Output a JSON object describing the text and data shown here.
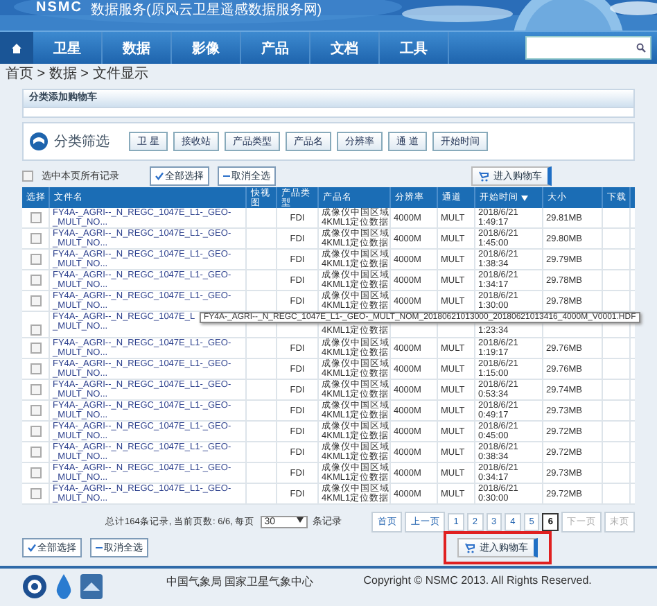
{
  "banner": {
    "logo": "NSMC",
    "title": "数据服务(原风云卫星遥感数据服务网)"
  },
  "nav": {
    "home_active": true,
    "items": [
      {
        "label": "卫星",
        "selected": false
      },
      {
        "label": "数据",
        "selected": false
      },
      {
        "label": "影像",
        "selected": false
      },
      {
        "label": "产品",
        "selected": false
      },
      {
        "label": "文档",
        "selected": false
      },
      {
        "label": "工具",
        "selected": false
      }
    ]
  },
  "breadcrumb": "首页 > 数据 > 文件显示",
  "cart_panel": {
    "title": "分类添加购物车"
  },
  "filter": {
    "title": "分类筛选",
    "buttons": [
      "卫 星",
      "接收站",
      "产品类型",
      "产品名",
      "分辨率",
      "通 道",
      "开始时间"
    ]
  },
  "toolbar": {
    "select_page": {
      "label": "选中本页所有记录",
      "checked": false
    },
    "select_all": "全部选择",
    "deselect": "取消全选",
    "cart": "进入购物车"
  },
  "table": {
    "columns": [
      {
        "label": "选择",
        "sorted": false
      },
      {
        "label": "文件名",
        "sorted": false
      },
      {
        "label": "快视图",
        "sorted": false
      },
      {
        "label": "产品类型",
        "sorted": false
      },
      {
        "label": "产品名",
        "sorted": false
      },
      {
        "label": "分辨率",
        "sorted": false
      },
      {
        "label": "通道",
        "sorted": false
      },
      {
        "label": "开始时间",
        "sorted": true
      },
      {
        "label": "大小",
        "sorted": false
      },
      {
        "label": "下载",
        "sorted": false
      }
    ],
    "rows": [
      {
        "checked": false,
        "file_name": [
          "FY4A-_AGRI--_N_REGC_1047E_L1-_GEO-",
          "_MULT_NO..."
        ],
        "product_type": "FDI",
        "product_name": [
          "成像仪中国区域",
          "4KML1定位数据"
        ],
        "resolution": "4000M",
        "channel": "MULT",
        "start_time": [
          "2018/6/21",
          "1:49:17"
        ],
        "size": "29.81MB"
      },
      {
        "checked": false,
        "file_name": [
          "FY4A-_AGRI--_N_REGC_1047E_L1-_GEO-",
          "_MULT_NO..."
        ],
        "product_type": "FDI",
        "product_name": [
          "成像仪中国区域",
          "4KML1定位数据"
        ],
        "resolution": "4000M",
        "channel": "MULT",
        "start_time": [
          "2018/6/21",
          "1:45:00"
        ],
        "size": "29.80MB"
      },
      {
        "checked": false,
        "file_name": [
          "FY4A-_AGRI--_N_REGC_1047E_L1-_GEO-",
          "_MULT_NO..."
        ],
        "product_type": "FDI",
        "product_name": [
          "成像仪中国区域",
          "4KML1定位数据"
        ],
        "resolution": "4000M",
        "channel": "MULT",
        "start_time": [
          "2018/6/21",
          "1:38:34"
        ],
        "size": "29.79MB"
      },
      {
        "checked": false,
        "file_name": [
          "FY4A-_AGRI--_N_REGC_1047E_L1-_GEO-",
          "_MULT_NO..."
        ],
        "product_type": "FDI",
        "product_name": [
          "成像仪中国区域",
          "4KML1定位数据"
        ],
        "resolution": "4000M",
        "channel": "MULT",
        "start_time": [
          "2018/6/21",
          "1:34:17"
        ],
        "size": "29.78MB"
      },
      {
        "checked": false,
        "file_name": [
          "FY4A-_AGRI--_N_REGC_1047E_L1-_GEO-",
          "_MULT_NO..."
        ],
        "product_type": "FDI",
        "product_name": [
          "成像仪中国区域",
          "4KML1定位数据"
        ],
        "resolution": "4000M",
        "channel": "MULT",
        "start_time": [
          "2018/6/21",
          "1:30:00"
        ],
        "size": "29.78MB"
      },
      {
        "checked": false,
        "file_name": [
          "FY4A-_AGRI--_N_REGC_1047E_L",
          "_MULT_NO..."
        ],
        "product_name": [
          "4KML1定位数据"
        ],
        "start_time": [
          "1:23:34"
        ],
        "tooltip": "FY4A-_AGRI--_N_REGC_1047E_L1-_GEO-_MULT_NOM_20180621013000_20180621013416_4000M_V0001.HDF"
      },
      {
        "checked": false,
        "file_name": [
          "FY4A-_AGRI--_N_REGC_1047E_L1-_GEO-",
          "_MULT_NO..."
        ],
        "product_type": "FDI",
        "product_name": [
          "成像仪中国区域",
          "4KML1定位数据"
        ],
        "resolution": "4000M",
        "channel": "MULT",
        "start_time": [
          "2018/6/21",
          "1:19:17"
        ],
        "size": "29.76MB"
      },
      {
        "checked": false,
        "file_name": [
          "FY4A-_AGRI--_N_REGC_1047E_L1-_GEO-",
          "_MULT_NO..."
        ],
        "product_type": "FDI",
        "product_name": [
          "成像仪中国区域",
          "4KML1定位数据"
        ],
        "resolution": "4000M",
        "channel": "MULT",
        "start_time": [
          "2018/6/21",
          "1:15:00"
        ],
        "size": "29.76MB"
      },
      {
        "checked": false,
        "file_name": [
          "FY4A-_AGRI--_N_REGC_1047E_L1-_GEO-",
          "_MULT_NO..."
        ],
        "product_type": "FDI",
        "product_name": [
          "成像仪中国区域",
          "4KML1定位数据"
        ],
        "resolution": "4000M",
        "channel": "MULT",
        "start_time": [
          "2018/6/21",
          "0:53:34"
        ],
        "size": "29.74MB"
      },
      {
        "checked": false,
        "file_name": [
          "FY4A-_AGRI--_N_REGC_1047E_L1-_GEO-",
          "_MULT_NO..."
        ],
        "product_type": "FDI",
        "product_name": [
          "成像仪中国区域",
          "4KML1定位数据"
        ],
        "resolution": "4000M",
        "channel": "MULT",
        "start_time": [
          "2018/6/21",
          "0:49:17"
        ],
        "size": "29.73MB"
      },
      {
        "checked": false,
        "file_name": [
          "FY4A-_AGRI--_N_REGC_1047E_L1-_GEO-",
          "_MULT_NO..."
        ],
        "product_type": "FDI",
        "product_name": [
          "成像仪中国区域",
          "4KML1定位数据"
        ],
        "resolution": "4000M",
        "channel": "MULT",
        "start_time": [
          "2018/6/21",
          "0:45:00"
        ],
        "size": "29.72MB"
      },
      {
        "checked": false,
        "file_name": [
          "FY4A-_AGRI--_N_REGC_1047E_L1-_GEO-",
          "_MULT_NO..."
        ],
        "product_type": "FDI",
        "product_name": [
          "成像仪中国区域",
          "4KML1定位数据"
        ],
        "resolution": "4000M",
        "channel": "MULT",
        "start_time": [
          "2018/6/21",
          "0:38:34"
        ],
        "size": "29.72MB"
      },
      {
        "checked": false,
        "file_name": [
          "FY4A-_AGRI--_N_REGC_1047E_L1-_GEO-",
          "_MULT_NO..."
        ],
        "product_type": "FDI",
        "product_name": [
          "成像仪中国区域",
          "4KML1定位数据"
        ],
        "resolution": "4000M",
        "channel": "MULT",
        "start_time": [
          "2018/6/21",
          "0:34:17"
        ],
        "size": "29.73MB"
      },
      {
        "checked": false,
        "file_name": [
          "FY4A-_AGRI--_N_REGC_1047E_L1-_GEO-",
          "_MULT_NO..."
        ],
        "product_type": "FDI",
        "product_name": [
          "成像仪中国区域",
          "4KML1定位数据"
        ],
        "resolution": "4000M",
        "channel": "MULT",
        "start_time": [
          "2018/6/21",
          "0:30:00"
        ],
        "size": "29.72MB"
      }
    ]
  },
  "pagination": {
    "summary": "总计164条记录, 当前页数: 6/6, 每页",
    "page_size": "30",
    "summary_suffix": "条记录",
    "pages": [
      {
        "label": "首页",
        "selected": false,
        "disabled": false
      },
      {
        "label": "上一页",
        "selected": false,
        "disabled": false
      },
      {
        "label": "1",
        "selected": false,
        "disabled": false
      },
      {
        "label": "2",
        "selected": false,
        "disabled": false
      },
      {
        "label": "3",
        "selected": false,
        "disabled": false
      },
      {
        "label": "4",
        "selected": false,
        "disabled": false
      },
      {
        "label": "5",
        "selected": false,
        "disabled": false
      },
      {
        "label": "6",
        "selected": true,
        "disabled": false
      },
      {
        "label": "下一页",
        "selected": false,
        "disabled": true
      },
      {
        "label": "末页",
        "selected": false,
        "disabled": true
      }
    ]
  },
  "bottom_actions": {
    "select_all": "全部选择",
    "deselect": "取消全选",
    "cart": "进入购物车",
    "cart_highlighted": true
  },
  "footer": {
    "org": "中国气象局 国家卫星气象中心",
    "copyright": "Copyright © NSMC 2013. All Rights Reserved."
  }
}
